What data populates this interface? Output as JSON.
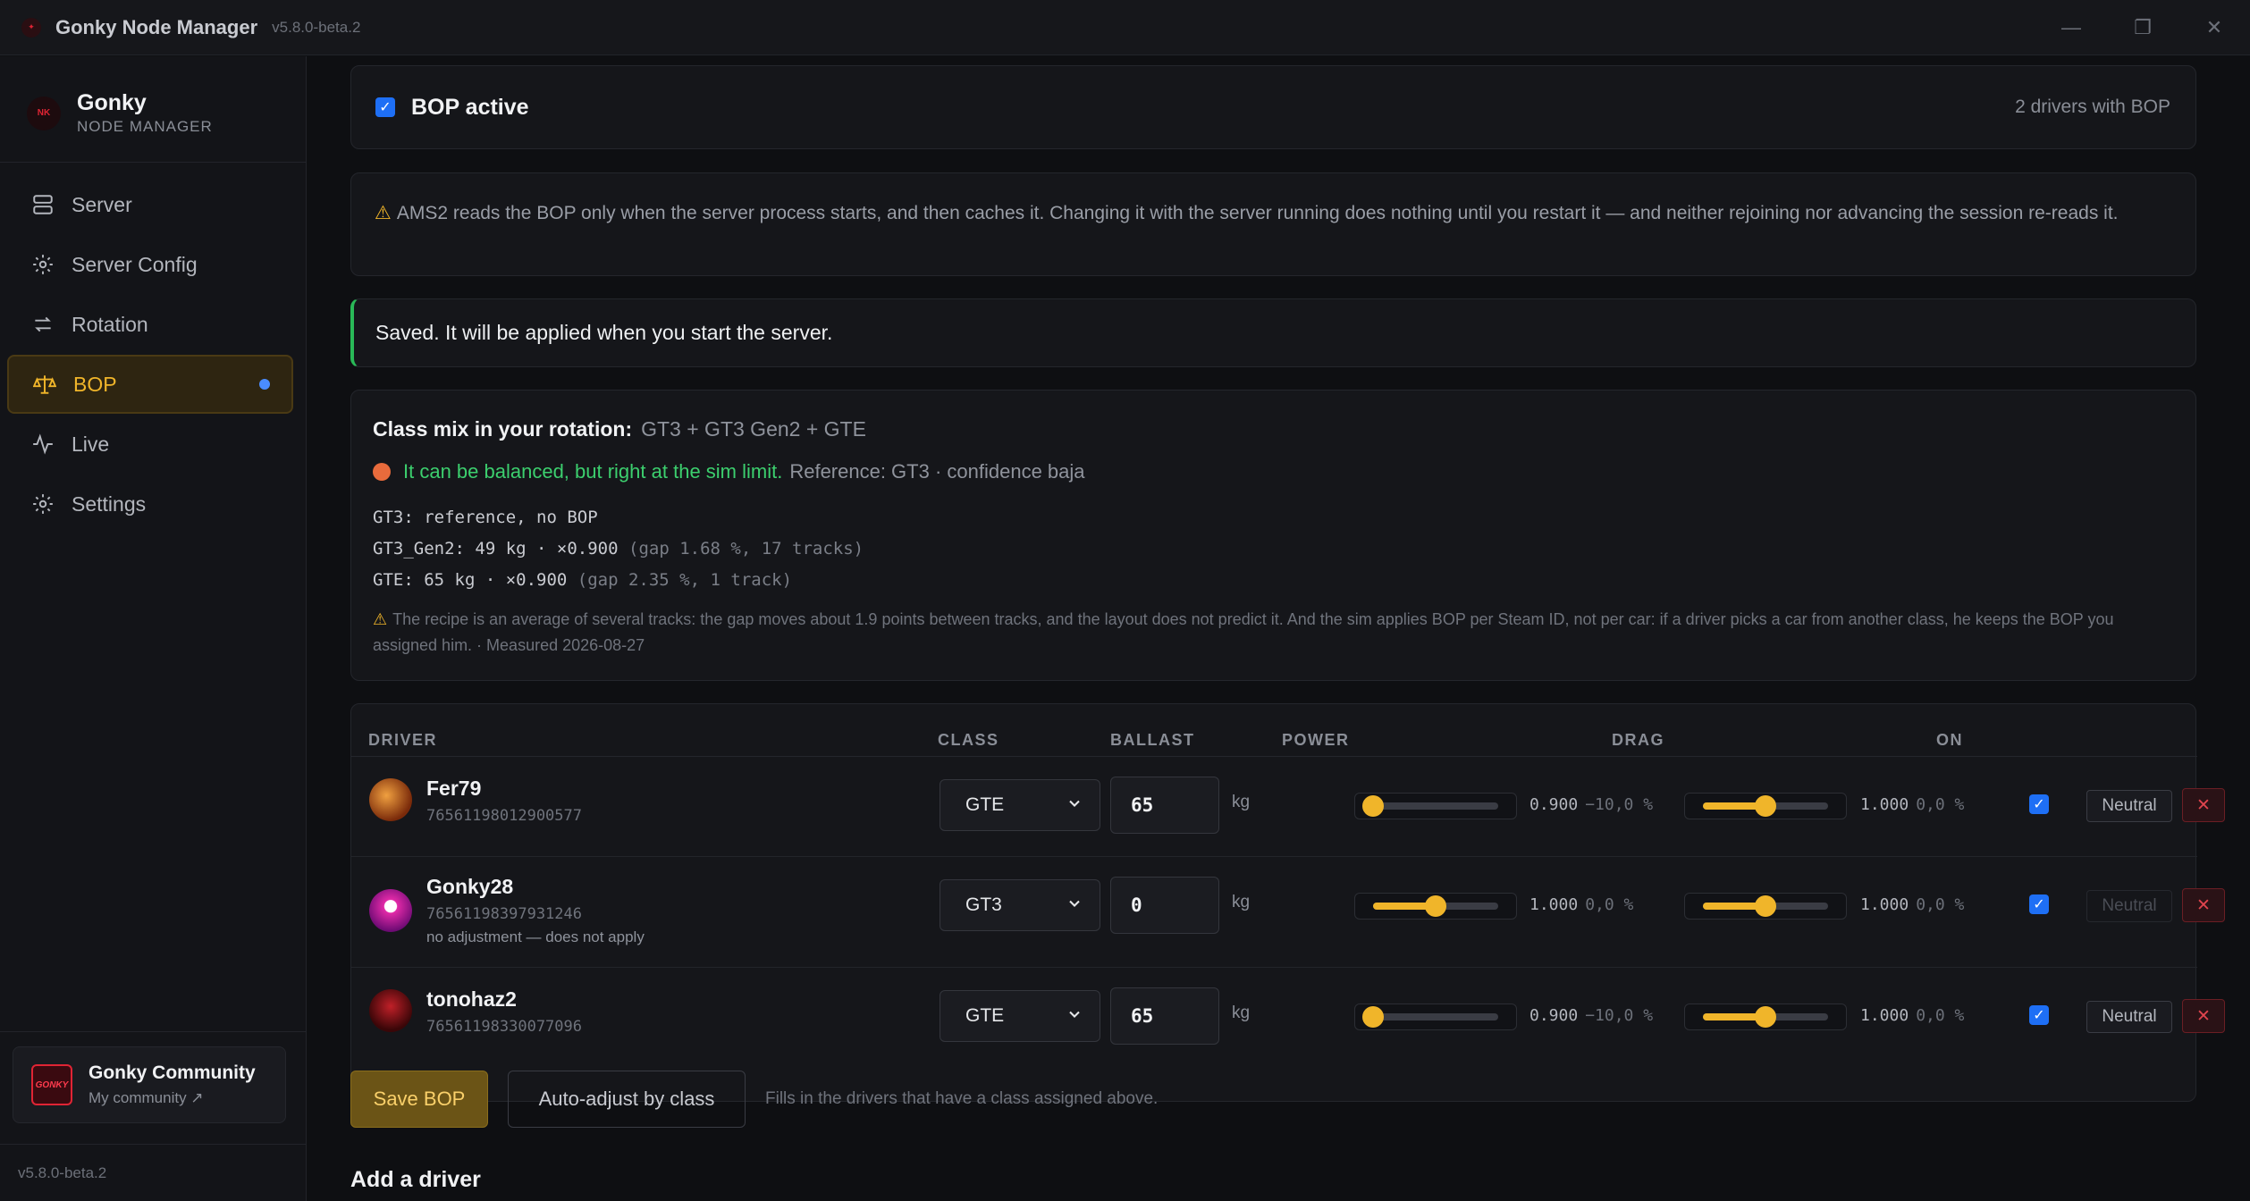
{
  "titlebar": {
    "title": "Gonky Node Manager",
    "version": "v5.8.0-beta.2",
    "minimize": "—",
    "maximize": "❐",
    "close": "✕"
  },
  "sidebar": {
    "brand_name": "Gonky",
    "brand_sub": "NODE MANAGER",
    "items": [
      {
        "label": "Server",
        "icon": "server-icon"
      },
      {
        "label": "Server Config",
        "icon": "gear-icon"
      },
      {
        "label": "Rotation",
        "icon": "rotation-icon"
      },
      {
        "label": "BOP",
        "icon": "scale-icon",
        "active": true
      },
      {
        "label": "Live",
        "icon": "pulse-icon"
      },
      {
        "label": "Settings",
        "icon": "gear-icon"
      }
    ],
    "community_name": "Gonky Community",
    "community_link": "My community ↗",
    "version": "v5.8.0-beta.2"
  },
  "bop": {
    "active_label": "BOP active",
    "drivers_count": "2 drivers with BOP"
  },
  "warning": {
    "text": "AMS2 reads the BOP only when the server process starts, and then caches it. Changing it with the server running does nothing until you restart it — and neither rejoining nor advancing the session re-reads it."
  },
  "saved": {
    "text": "Saved. It will be applied when you start the server."
  },
  "class_mix": {
    "title": "Class mix in your rotation:",
    "value": "GT3 + GT3 Gen2 + GTE",
    "status_green": "It can be balanced, but right at the sim limit.",
    "status_ref": "Reference: GT3 · confidence baja",
    "lines": [
      {
        "main": "GT3: reference, no BOP",
        "dim": ""
      },
      {
        "main": "GT3_Gen2: 49 kg · ×0.900",
        "dim": "(gap 1.68 %, 17 tracks)"
      },
      {
        "main": "GTE: 65 kg · ×0.900",
        "dim": "(gap 2.35 %, 1 track)"
      }
    ],
    "note": "The recipe is an average of several tracks: the gap moves about 1.9 points between tracks, and the layout does not predict it. And the sim applies BOP per Steam ID, not per car: if a driver picks a car from another class, he keeps the BOP you assigned him. · Measured 2026-08-27"
  },
  "table": {
    "headers": {
      "driver": "DRIVER",
      "class": "CLASS",
      "ballast": "BALLAST",
      "power": "POWER",
      "drag": "DRAG",
      "on": "ON"
    },
    "unit": "kg",
    "neutral_label": "Neutral",
    "rows": [
      {
        "name": "Fer79",
        "id": "76561198012900577",
        "note": "",
        "class": "GTE",
        "ballast": "65",
        "power_val": "0.900",
        "power_pct": "−10,0 %",
        "power_level": 0.0,
        "drag_val": "1.000",
        "drag_pct": "0,0 %",
        "drag_level": 0.5,
        "neutral_enabled": true,
        "avatar_color": "#c0521a"
      },
      {
        "name": "Gonky28",
        "id": "76561198397931246",
        "note": "no adjustment — does not apply",
        "class": "GT3",
        "ballast": "0",
        "power_val": "1.000",
        "power_pct": "0,0 %",
        "power_level": 0.5,
        "drag_val": "1.000",
        "drag_pct": "0,0 %",
        "drag_level": 0.5,
        "neutral_enabled": false,
        "avatar_color": "#d61ea8"
      },
      {
        "name": "tonohaz2",
        "id": "76561198330077096",
        "note": "",
        "class": "GTE",
        "ballast": "65",
        "power_val": "0.900",
        "power_pct": "−10,0 %",
        "power_level": 0.0,
        "drag_val": "1.000",
        "drag_pct": "0,0 %",
        "drag_level": 0.5,
        "neutral_enabled": true,
        "avatar_color": "#7a1418"
      }
    ]
  },
  "actions": {
    "save": "Save BOP",
    "auto": "Auto-adjust by class",
    "hint": "Fills in the drivers that have a class assigned above."
  },
  "add_driver": {
    "title": "Add a driver"
  },
  "colors": {
    "accent": "#f0b52a",
    "ok": "#3ccf6e",
    "danger": "#e0444e",
    "checkbox": "#1e6ff5"
  }
}
